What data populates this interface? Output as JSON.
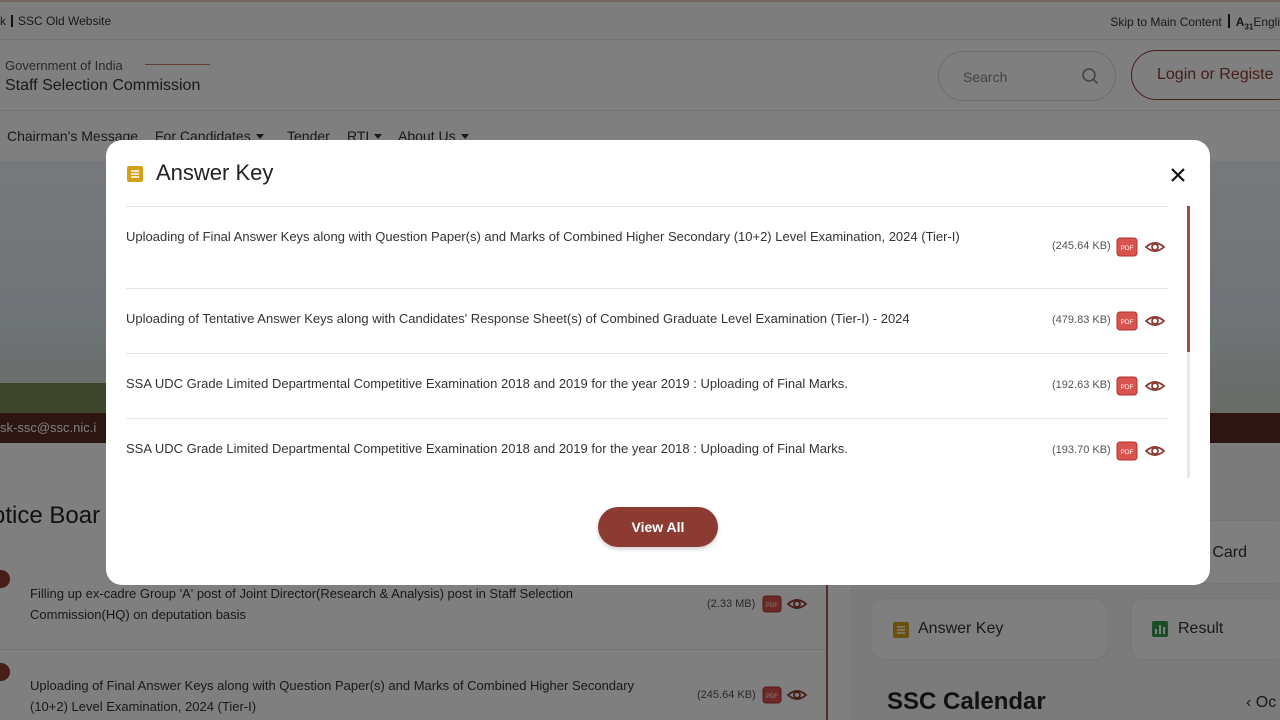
{
  "topbar": {
    "left_text_fragment": "k",
    "old_website": "SSC Old Website",
    "skip": "Skip to Main Content",
    "language": "Engli"
  },
  "header": {
    "gov": "Government of India",
    "org": "Staff Selection Commission",
    "search_placeholder": "Search",
    "login": "Login or Registe"
  },
  "nav": {
    "items": [
      "Chairman's Message",
      "For Candidates",
      "Tender",
      "RTI",
      "About Us"
    ]
  },
  "strip": {
    "email": "sk-ssc@ssc.nic.i"
  },
  "notice": {
    "title": "otice Boar",
    "rows": [
      {
        "text": "Filling up ex-cadre Group 'A' post of Joint Director(Research & Analysis) post in Staff Selection Commission(HQ) on deputation basis",
        "size": "(2.33 MB)"
      },
      {
        "text": "Uploading of Final Answer Keys along with Question Paper(s) and Marks of Combined Higher Secondary (10+2) Level Examination, 2024 (Tier-I)",
        "size": "(245.64 KB)"
      }
    ]
  },
  "side": {
    "admit_card": "nit Card",
    "answer_key": "Answer Key",
    "result": "Result",
    "calendar_title": "SSC Calendar",
    "calendar_nav": "Oc"
  },
  "modal": {
    "title": "Answer Key",
    "rows": [
      {
        "text": "Uploading of Final Answer Keys along with Question Paper(s) and Marks of Combined Higher Secondary (10+2) Level Examination, 2024 (Tier-I)",
        "size": "(245.64 KB)"
      },
      {
        "text": "Uploading of Tentative Answer Keys along with Candidates' Response Sheet(s) of Combined Graduate Level Examination (Tier-I) - 2024",
        "size": "(479.83 KB)"
      },
      {
        "text": "SSA UDC Grade Limited Departmental Competitive Examination 2018 and 2019 for the year 2019 : Uploading of Final Marks.",
        "size": "(192.63 KB)"
      },
      {
        "text": "SSA UDC Grade Limited Departmental Competitive Examination 2018 and 2019 for the year 2018 : Uploading of Final Marks.",
        "size": "(193.70 KB)"
      }
    ],
    "view_all": "View All",
    "pdf_label": "PDF"
  },
  "colors": {
    "brand": "#8c3b33",
    "accent": "#d4a017",
    "overlay": "rgba(0,0,0,0.5)"
  }
}
